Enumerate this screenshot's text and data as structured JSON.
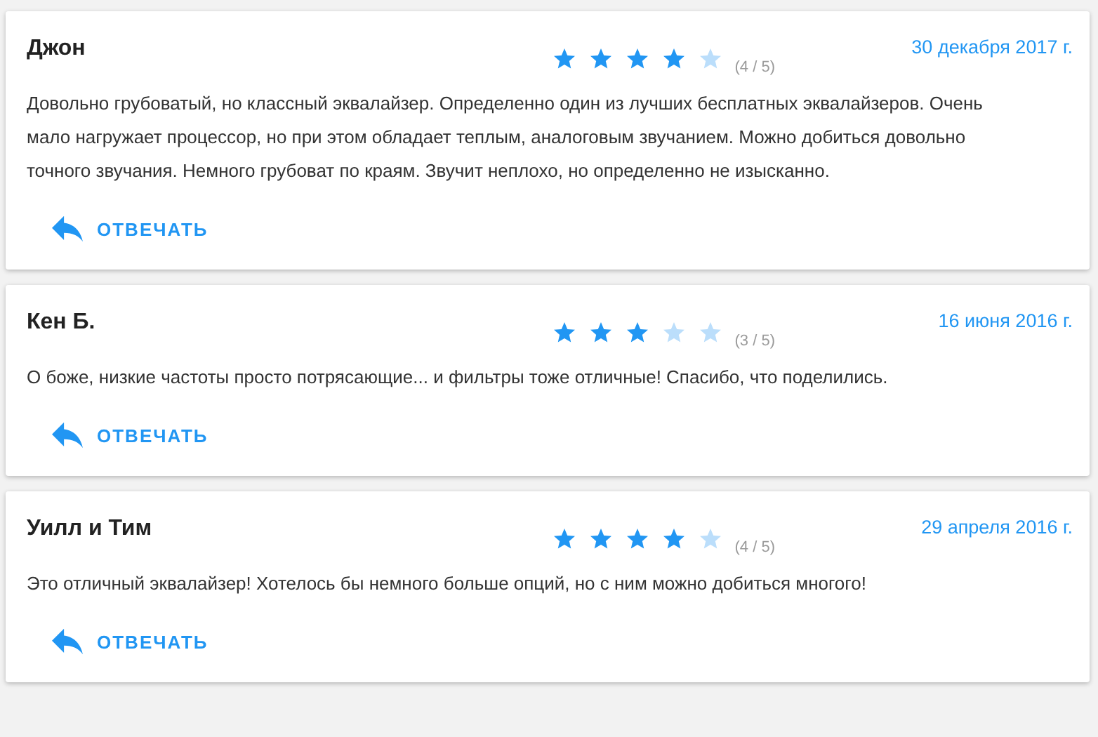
{
  "reviews": [
    {
      "author": "Джон",
      "stars": 4,
      "rating_text": "(4 / 5)",
      "date": "30 декабря 2017 г.",
      "text": "Довольно грубоватый, но классный эквалайзер. Определенно один из лучших бесплатных эквалайзеров. Очень мало нагружает процессор, но при этом обладает теплым, аналоговым звучанием. Можно добиться довольно точного звучания. Немного грубоват по краям. Звучит неплохо, но определенно не изысканно.",
      "reply_label": "ОТВЕЧАТЬ"
    },
    {
      "author": "Кен Б.",
      "stars": 3,
      "rating_text": "(3 / 5)",
      "date": "16 июня 2016 г.",
      "text": "О боже, низкие частоты просто потрясающие... и фильтры тоже отличные! Спасибо, что поделились.",
      "reply_label": "ОТВЕЧАТЬ"
    },
    {
      "author": "Уилл и Тим",
      "stars": 4,
      "rating_text": "(4 / 5)",
      "date": "29 апреля 2016 г.",
      "text": "Это отличный эквалайзер! Хотелось бы немного больше опций, но с ним можно добиться многого!",
      "reply_label": "ОТВЕЧАТЬ"
    }
  ]
}
